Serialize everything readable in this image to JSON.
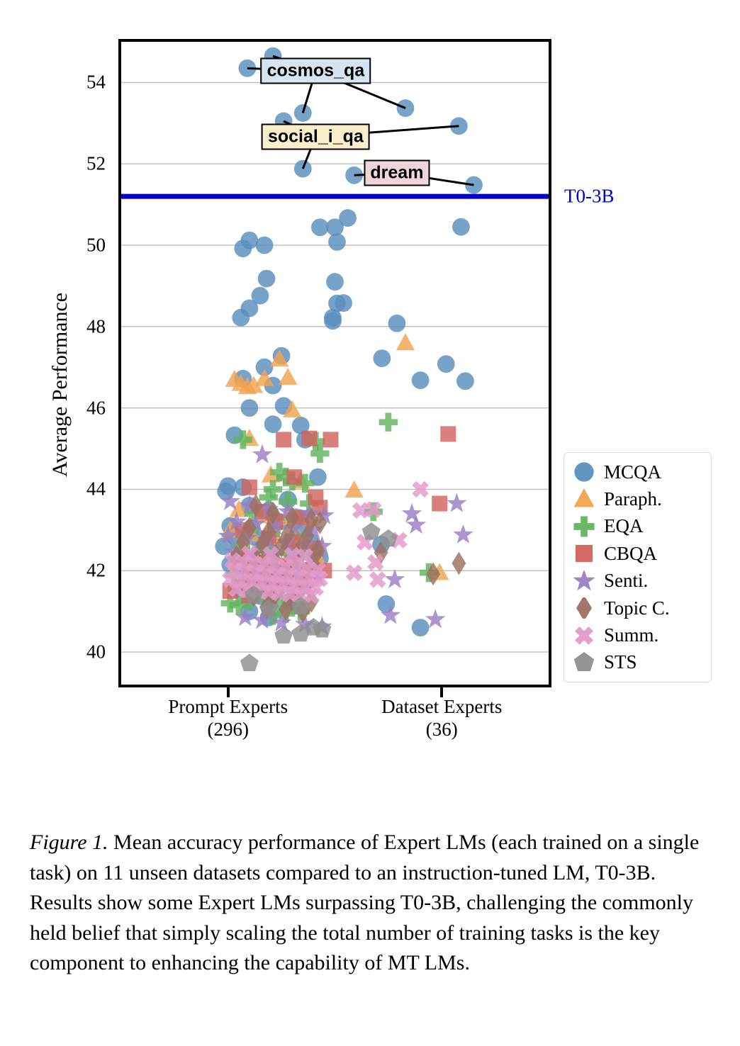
{
  "figure": {
    "number_label": "Figure 1.",
    "caption": " Mean accuracy performance of Expert LMs (each trained on a single task) on 11 unseen datasets compared to an instruction-tuned LM, T0-3B. Results show some Expert LMs surpassing T0-3B, challenging the commonly held belief that simply scaling the total number of training tasks is the key component to enhancing the capability of MT LMs."
  },
  "chart_data": {
    "type": "scatter",
    "title": "",
    "xlabel": "",
    "ylabel": "Average Performance",
    "ylim": [
      39.2,
      55.0
    ],
    "yticks": [
      40,
      42,
      44,
      46,
      48,
      50,
      52,
      54
    ],
    "ytick_labels": [
      "40",
      "42",
      "44",
      "46",
      "48",
      "50",
      "52",
      "54"
    ],
    "grid": "horizontal",
    "xticks": [
      1,
      2
    ],
    "xtick_labels": [
      "Prompt Experts",
      "Dataset Experts"
    ],
    "xtick_sublabels": [
      "(296)",
      "(36)"
    ],
    "legend_position": "right",
    "reference_line": {
      "label": "T0-3B",
      "value": 51.2,
      "color": "#0000cc"
    },
    "series": [
      {
        "name": "MCQA",
        "marker": "circle",
        "color": "#5a8fbd"
      },
      {
        "name": "Paraph.",
        "marker": "triangle",
        "color": "#f0a350"
      },
      {
        "name": "EQA",
        "marker": "plus",
        "color": "#62b35e"
      },
      {
        "name": "CBQA",
        "marker": "square",
        "color": "#d1635f"
      },
      {
        "name": "Senti.",
        "marker": "star",
        "color": "#9b7fc4"
      },
      {
        "name": "Topic C.",
        "marker": "diamond",
        "color": "#9d6f62"
      },
      {
        "name": "Summ.",
        "marker": "cross",
        "color": "#e39ac9"
      },
      {
        "name": "STS",
        "marker": "pentagon",
        "color": "#8f8f8f"
      }
    ],
    "annotations": [
      {
        "label": "cosmos_qa",
        "box_color": "#d6e3f0",
        "box_x": 0.455,
        "box_y": 54.28
      },
      {
        "label": "social_i_qa",
        "box_color": "#fbeecb",
        "box_x": 0.455,
        "box_y": 52.67
      },
      {
        "label": "dream",
        "box_color": "#eed5d7",
        "box_x": 0.645,
        "box_y": 51.77
      }
    ],
    "points": {
      "MCQA": [
        [
          0.295,
          54.35
        ],
        [
          0.355,
          54.65
        ],
        [
          0.415,
          54.18
        ],
        [
          0.425,
          53.25
        ],
        [
          0.38,
          53.05
        ],
        [
          0.665,
          53.37
        ],
        [
          0.79,
          52.93
        ],
        [
          0.425,
          51.88
        ],
        [
          0.545,
          51.72
        ],
        [
          0.825,
          51.48
        ],
        [
          0.465,
          50.44
        ],
        [
          0.5,
          50.44
        ],
        [
          0.505,
          50.08
        ],
        [
          0.53,
          50.67
        ],
        [
          0.3,
          50.12
        ],
        [
          0.285,
          49.92
        ],
        [
          0.335,
          50.0
        ],
        [
          0.795,
          50.45
        ],
        [
          0.34,
          49.18
        ],
        [
          0.5,
          49.1
        ],
        [
          0.325,
          48.76
        ],
        [
          0.3,
          48.45
        ],
        [
          0.28,
          48.22
        ],
        [
          0.495,
          48.22
        ],
        [
          0.505,
          48.57
        ],
        [
          0.52,
          48.58
        ],
        [
          0.495,
          48.14
        ],
        [
          0.645,
          48.08
        ],
        [
          0.61,
          47.22
        ],
        [
          0.76,
          47.08
        ],
        [
          0.7,
          46.68
        ],
        [
          0.805,
          46.66
        ],
        [
          0.335,
          47.0
        ],
        [
          0.285,
          46.72
        ],
        [
          0.375,
          47.28
        ],
        [
          0.355,
          46.55
        ],
        [
          0.3,
          46.0
        ],
        [
          0.38,
          46.05
        ],
        [
          0.265,
          45.33
        ],
        [
          0.42,
          45.57
        ],
        [
          0.355,
          45.6
        ],
        [
          0.43,
          45.22
        ],
        [
          0.25,
          44.08
        ],
        [
          0.285,
          44.05
        ],
        [
          0.46,
          44.3
        ],
        [
          0.245,
          43.95
        ],
        [
          0.3,
          43.6
        ],
        [
          0.39,
          43.75
        ],
        [
          0.345,
          43.48
        ],
        [
          0.415,
          43.3
        ],
        [
          0.255,
          43.1
        ],
        [
          0.305,
          43.05
        ],
        [
          0.37,
          43.2
        ],
        [
          0.43,
          43.05
        ],
        [
          0.265,
          42.85
        ],
        [
          0.325,
          42.75
        ],
        [
          0.395,
          42.6
        ],
        [
          0.445,
          42.7
        ],
        [
          0.24,
          42.6
        ],
        [
          0.285,
          42.4
        ],
        [
          0.35,
          42.45
        ],
        [
          0.41,
          42.35
        ],
        [
          0.465,
          42.3
        ],
        [
          0.255,
          42.15
        ],
        [
          0.31,
          42.05
        ],
        [
          0.375,
          42.1
        ],
        [
          0.43,
          42.0
        ],
        [
          0.295,
          41.8
        ],
        [
          0.355,
          41.75
        ],
        [
          0.4,
          41.7
        ],
        [
          0.27,
          41.55
        ],
        [
          0.335,
          41.35
        ],
        [
          0.395,
          41.25
        ],
        [
          0.3,
          41.0
        ],
        [
          0.345,
          40.85
        ],
        [
          0.608,
          42.64
        ],
        [
          0.62,
          41.18
        ],
        [
          0.7,
          40.6
        ]
      ],
      "Paraph.": [
        [
          0.265,
          46.7
        ],
        [
          0.28,
          46.6
        ],
        [
          0.295,
          46.52
        ],
        [
          0.31,
          46.55
        ],
        [
          0.335,
          46.72
        ],
        [
          0.37,
          47.2
        ],
        [
          0.39,
          46.75
        ],
        [
          0.4,
          45.95
        ],
        [
          0.3,
          45.25
        ],
        [
          0.35,
          44.35
        ],
        [
          0.42,
          44.2
        ],
        [
          0.275,
          43.5
        ],
        [
          0.33,
          43.35
        ],
        [
          0.385,
          43.3
        ],
        [
          0.44,
          43.28
        ],
        [
          0.255,
          43.0
        ],
        [
          0.305,
          42.9
        ],
        [
          0.36,
          42.85
        ],
        [
          0.415,
          42.8
        ],
        [
          0.285,
          42.55
        ],
        [
          0.34,
          42.45
        ],
        [
          0.395,
          42.4
        ],
        [
          0.27,
          42.2
        ],
        [
          0.325,
          42.1
        ],
        [
          0.38,
          42.05
        ],
        [
          0.3,
          41.85
        ],
        [
          0.355,
          41.8
        ],
        [
          0.41,
          41.75
        ],
        [
          0.46,
          42.3
        ],
        [
          0.665,
          47.6
        ],
        [
          0.545,
          43.98
        ],
        [
          0.745,
          41.95
        ]
      ],
      "EQA": [
        [
          0.285,
          45.22
        ],
        [
          0.37,
          44.42
        ],
        [
          0.385,
          44.3
        ],
        [
          0.4,
          44.2
        ],
        [
          0.43,
          44.15
        ],
        [
          0.355,
          44.0
        ],
        [
          0.345,
          43.8
        ],
        [
          0.39,
          43.7
        ],
        [
          0.44,
          43.65
        ],
        [
          0.465,
          44.88
        ],
        [
          0.455,
          45.18
        ],
        [
          0.31,
          43.4
        ],
        [
          0.36,
          43.3
        ],
        [
          0.41,
          43.25
        ],
        [
          0.3,
          43.0
        ],
        [
          0.35,
          42.9
        ],
        [
          0.405,
          42.85
        ],
        [
          0.28,
          42.6
        ],
        [
          0.335,
          42.5
        ],
        [
          0.39,
          42.45
        ],
        [
          0.445,
          42.4
        ],
        [
          0.29,
          42.2
        ],
        [
          0.345,
          42.1
        ],
        [
          0.4,
          42.05
        ],
        [
          0.265,
          41.9
        ],
        [
          0.32,
          41.8
        ],
        [
          0.375,
          41.7
        ],
        [
          0.43,
          41.65
        ],
        [
          0.255,
          41.2
        ],
        [
          0.275,
          41.15
        ],
        [
          0.3,
          41.25
        ],
        [
          0.34,
          41.3
        ],
        [
          0.37,
          41.2
        ],
        [
          0.41,
          41.18
        ],
        [
          0.355,
          40.9
        ],
        [
          0.385,
          40.95
        ],
        [
          0.42,
          41.0
        ],
        [
          0.625,
          45.65
        ],
        [
          0.59,
          43.45
        ],
        [
          0.72,
          41.95
        ]
      ],
      "CBQA": [
        [
          0.38,
          45.22
        ],
        [
          0.44,
          45.25
        ],
        [
          0.49,
          45.22
        ],
        [
          0.405,
          44.3
        ],
        [
          0.455,
          43.8
        ],
        [
          0.465,
          43.55
        ],
        [
          0.3,
          44.05
        ],
        [
          0.33,
          43.45
        ],
        [
          0.36,
          43.2
        ],
        [
          0.42,
          43.3
        ],
        [
          0.285,
          43.0
        ],
        [
          0.345,
          42.8
        ],
        [
          0.4,
          42.7
        ],
        [
          0.455,
          42.55
        ],
        [
          0.275,
          42.3
        ],
        [
          0.33,
          42.2
        ],
        [
          0.385,
          42.1
        ],
        [
          0.44,
          42.0
        ],
        [
          0.31,
          41.8
        ],
        [
          0.365,
          41.7
        ],
        [
          0.255,
          41.5
        ],
        [
          0.3,
          41.4
        ],
        [
          0.475,
          42.0
        ],
        [
          0.765,
          45.36
        ],
        [
          0.745,
          43.65
        ]
      ],
      "Senti.": [
        [
          0.33,
          44.85
        ],
        [
          0.255,
          43.7
        ],
        [
          0.3,
          43.6
        ],
        [
          0.345,
          43.5
        ],
        [
          0.39,
          43.45
        ],
        [
          0.44,
          43.4
        ],
        [
          0.475,
          43.35
        ],
        [
          0.27,
          43.2
        ],
        [
          0.315,
          43.15
        ],
        [
          0.36,
          43.1
        ],
        [
          0.405,
          43.05
        ],
        [
          0.45,
          43.0
        ],
        [
          0.25,
          42.85
        ],
        [
          0.295,
          42.8
        ],
        [
          0.34,
          42.75
        ],
        [
          0.385,
          42.7
        ],
        [
          0.43,
          42.65
        ],
        [
          0.47,
          42.6
        ],
        [
          0.265,
          42.45
        ],
        [
          0.31,
          42.4
        ],
        [
          0.355,
          42.35
        ],
        [
          0.4,
          42.3
        ],
        [
          0.445,
          42.25
        ],
        [
          0.28,
          42.05
        ],
        [
          0.325,
          42.0
        ],
        [
          0.37,
          41.95
        ],
        [
          0.415,
          41.9
        ],
        [
          0.46,
          41.85
        ],
        [
          0.295,
          41.7
        ],
        [
          0.34,
          41.65
        ],
        [
          0.385,
          41.6
        ],
        [
          0.43,
          41.55
        ],
        [
          0.31,
          41.35
        ],
        [
          0.355,
          41.3
        ],
        [
          0.4,
          41.25
        ],
        [
          0.29,
          40.85
        ],
        [
          0.33,
          40.78
        ],
        [
          0.375,
          40.72
        ],
        [
          0.43,
          40.68
        ],
        [
          0.47,
          40.62
        ],
        [
          0.64,
          41.78
        ],
        [
          0.68,
          43.4
        ],
        [
          0.69,
          43.12
        ],
        [
          0.8,
          42.88
        ],
        [
          0.785,
          43.65
        ],
        [
          0.63,
          40.9
        ],
        [
          0.735,
          40.8
        ]
      ],
      "Topic C.": [
        [
          0.315,
          43.6
        ],
        [
          0.355,
          43.42
        ],
        [
          0.4,
          43.3
        ],
        [
          0.445,
          43.25
        ],
        [
          0.465,
          43.18
        ],
        [
          0.3,
          43.05
        ],
        [
          0.345,
          42.95
        ],
        [
          0.39,
          42.9
        ],
        [
          0.435,
          42.85
        ],
        [
          0.285,
          42.7
        ],
        [
          0.33,
          42.65
        ],
        [
          0.375,
          42.6
        ],
        [
          0.42,
          42.55
        ],
        [
          0.46,
          42.5
        ],
        [
          0.27,
          42.35
        ],
        [
          0.315,
          42.3
        ],
        [
          0.36,
          42.25
        ],
        [
          0.405,
          42.2
        ],
        [
          0.45,
          42.15
        ],
        [
          0.3,
          42.0
        ],
        [
          0.345,
          41.95
        ],
        [
          0.39,
          41.9
        ],
        [
          0.435,
          41.85
        ],
        [
          0.285,
          41.7
        ],
        [
          0.33,
          41.65
        ],
        [
          0.375,
          41.6
        ],
        [
          0.42,
          41.55
        ],
        [
          0.31,
          41.4
        ],
        [
          0.355,
          41.35
        ],
        [
          0.4,
          41.3
        ],
        [
          0.445,
          41.25
        ],
        [
          0.34,
          41.1
        ],
        [
          0.385,
          41.05
        ],
        [
          0.425,
          41.0
        ],
        [
          0.608,
          42.45
        ],
        [
          0.73,
          41.92
        ],
        [
          0.79,
          42.18
        ]
      ],
      "Summ.": [
        [
          0.26,
          42.25
        ],
        [
          0.285,
          42.2
        ],
        [
          0.31,
          42.18
        ],
        [
          0.335,
          42.15
        ],
        [
          0.36,
          42.12
        ],
        [
          0.385,
          42.1
        ],
        [
          0.41,
          42.08
        ],
        [
          0.435,
          42.05
        ],
        [
          0.46,
          42.02
        ],
        [
          0.265,
          42.0
        ],
        [
          0.29,
          41.98
        ],
        [
          0.315,
          41.95
        ],
        [
          0.34,
          41.92
        ],
        [
          0.365,
          41.9
        ],
        [
          0.39,
          41.88
        ],
        [
          0.415,
          41.85
        ],
        [
          0.44,
          41.82
        ],
        [
          0.465,
          41.8
        ],
        [
          0.255,
          41.78
        ],
        [
          0.28,
          41.75
        ],
        [
          0.305,
          41.72
        ],
        [
          0.33,
          41.7
        ],
        [
          0.355,
          41.68
        ],
        [
          0.38,
          41.65
        ],
        [
          0.405,
          41.62
        ],
        [
          0.43,
          41.6
        ],
        [
          0.455,
          41.58
        ],
        [
          0.27,
          41.55
        ],
        [
          0.295,
          41.52
        ],
        [
          0.32,
          41.5
        ],
        [
          0.345,
          41.48
        ],
        [
          0.37,
          41.45
        ],
        [
          0.395,
          41.42
        ],
        [
          0.42,
          41.4
        ],
        [
          0.445,
          41.38
        ],
        [
          0.3,
          42.42
        ],
        [
          0.35,
          42.4
        ],
        [
          0.4,
          42.38
        ],
        [
          0.43,
          42.35
        ],
        [
          0.7,
          44.0
        ],
        [
          0.57,
          42.7
        ],
        [
          0.65,
          42.75
        ],
        [
          0.59,
          43.5
        ],
        [
          0.545,
          41.95
        ],
        [
          0.6,
          41.78
        ],
        [
          0.595,
          42.2
        ],
        [
          0.56,
          43.48
        ]
      ],
      "STS": [
        [
          0.3,
          39.72
        ],
        [
          0.38,
          40.4
        ],
        [
          0.42,
          40.45
        ],
        [
          0.45,
          40.6
        ],
        [
          0.47,
          40.55
        ],
        [
          0.345,
          41.05
        ],
        [
          0.31,
          41.4
        ],
        [
          0.42,
          41.12
        ],
        [
          0.585,
          42.95
        ],
        [
          0.625,
          42.78
        ]
      ]
    }
  }
}
